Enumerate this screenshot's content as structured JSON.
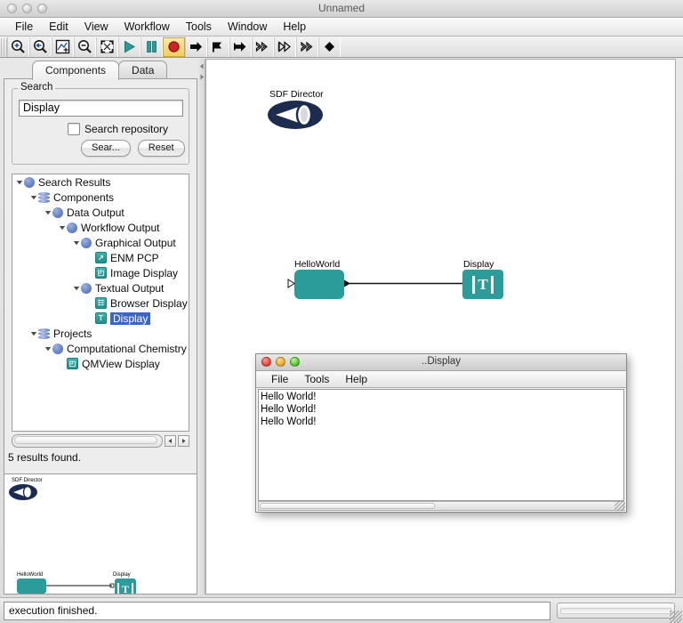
{
  "window": {
    "title": "Unnamed",
    "traffic_lights": [
      "close",
      "minimize",
      "zoom"
    ]
  },
  "menubar": {
    "items": [
      {
        "label": "File"
      },
      {
        "label": "Edit"
      },
      {
        "label": "View"
      },
      {
        "label": "Workflow"
      },
      {
        "label": "Tools"
      },
      {
        "label": "Window"
      },
      {
        "label": "Help"
      }
    ]
  },
  "toolbar": {
    "buttons": [
      {
        "name": "zoom-in-icon",
        "title": "Zoom In"
      },
      {
        "name": "zoom-reset-icon",
        "title": "Zoom Reset"
      },
      {
        "name": "zoom-fit-icon",
        "title": "Zoom Fit"
      },
      {
        "name": "zoom-out-icon",
        "title": "Zoom Out"
      },
      {
        "name": "fullscreen-icon",
        "title": "Full Screen"
      },
      {
        "name": "run-icon",
        "title": "Run"
      },
      {
        "name": "pause-icon",
        "title": "Pause"
      },
      {
        "name": "stop-icon",
        "title": "Stop",
        "highlighted": true
      },
      {
        "name": "step-forward-icon",
        "title": "Step"
      },
      {
        "name": "step-to-flag-icon",
        "title": "Run to Breakpoint"
      },
      {
        "name": "step-arrow-icon",
        "title": "Step Arrow"
      },
      {
        "name": "fast-forward-filled-icon",
        "title": "Fast Forward"
      },
      {
        "name": "fast-forward-outline-icon",
        "title": "Fast Forward Outline"
      },
      {
        "name": "fast-forward-hollow-icon",
        "title": "Fast Forward Hollow"
      },
      {
        "name": "diamond-icon",
        "title": "Diamond"
      }
    ]
  },
  "left_panel": {
    "tabs": [
      {
        "label": "Components",
        "active": true
      },
      {
        "label": "Data",
        "active": false
      }
    ],
    "search": {
      "legend": "Search",
      "value": "Display",
      "placeholder": "",
      "checkbox_label": "Search repository",
      "checkbox_checked": false,
      "search_button": "Sear...",
      "reset_button": "Reset"
    },
    "tree": [
      {
        "label": "Search Results",
        "depth": 0,
        "twisty": "down",
        "icon": "ball",
        "selected": false
      },
      {
        "label": "Components",
        "depth": 1,
        "twisty": "down",
        "icon": "stack",
        "selected": false
      },
      {
        "label": "Data Output",
        "depth": 2,
        "twisty": "down",
        "icon": "ball",
        "selected": false
      },
      {
        "label": "Workflow Output",
        "depth": 3,
        "twisty": "down",
        "icon": "ball",
        "selected": false
      },
      {
        "label": "Graphical Output",
        "depth": 4,
        "twisty": "down",
        "icon": "ball",
        "selected": false
      },
      {
        "label": "ENM PCP",
        "depth": 5,
        "twisty": "none",
        "icon": "leaf-chart",
        "glyph": "↗",
        "selected": false
      },
      {
        "label": "Image Display",
        "depth": 5,
        "twisty": "none",
        "icon": "leaf-image",
        "glyph": "◰",
        "selected": false
      },
      {
        "label": "Textual Output",
        "depth": 4,
        "twisty": "down",
        "icon": "ball",
        "selected": false
      },
      {
        "label": "Browser Display",
        "depth": 5,
        "twisty": "none",
        "icon": "leaf-browser",
        "glyph": "☷",
        "selected": false
      },
      {
        "label": "Display",
        "depth": 5,
        "twisty": "none",
        "icon": "leaf-text",
        "glyph": "T",
        "selected": true
      },
      {
        "label": "Projects",
        "depth": 1,
        "twisty": "down",
        "icon": "stack",
        "selected": false
      },
      {
        "label": "Computational Chemistry",
        "depth": 2,
        "twisty": "down",
        "icon": "ball",
        "selected": false
      },
      {
        "label": "QMView Display",
        "depth": 3,
        "twisty": "none",
        "icon": "leaf-image",
        "glyph": "◰",
        "selected": false
      }
    ],
    "results_text": "5 results found."
  },
  "canvas": {
    "director": {
      "label": "SDF Director"
    },
    "nodes": [
      {
        "name": "HelloWorld",
        "label": "HelloWorld",
        "type": "actor"
      },
      {
        "name": "Display",
        "label": "Display",
        "type": "display",
        "glyph": "T"
      }
    ]
  },
  "thumbnail": {
    "director_label": "SDF Director",
    "node_labels": [
      "HelloWorld",
      "Display"
    ],
    "display_glyph": "T"
  },
  "display_window": {
    "title": "..Display",
    "menu": [
      {
        "label": "File"
      },
      {
        "label": "Tools"
      },
      {
        "label": "Help"
      }
    ],
    "lines": [
      "Hello World!",
      "Hello World!",
      "Hello World!"
    ]
  },
  "status": {
    "message": "execution finished.",
    "progress_percent": 0
  },
  "colors": {
    "node_teal": "#2c9c9a",
    "director_navy": "#1b2c4f",
    "selection_blue": "#3d64c8",
    "stop_red": "#cf2222",
    "highlight_amber": "#f3cf5f"
  }
}
